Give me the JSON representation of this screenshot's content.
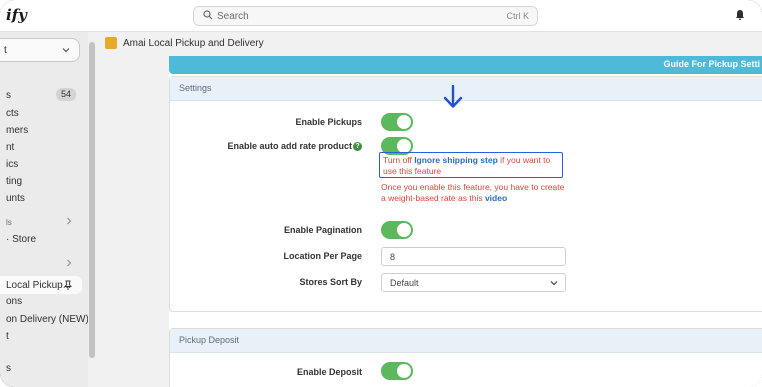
{
  "topbar": {
    "logo": "ify",
    "search_placeholder": "Search",
    "search_shortcut": "Ctrl K"
  },
  "sidebar": {
    "store_select": "t",
    "items": [
      {
        "label": "s",
        "badge": "54"
      },
      {
        "label": "cts"
      },
      {
        "label": "mers"
      },
      {
        "label": "nt"
      },
      {
        "label": "ics"
      },
      {
        "label": "ting"
      },
      {
        "label": "unts"
      }
    ],
    "section_sales": "ls",
    "online_store": "· Store",
    "active_app": "Local Pickup...",
    "sub_items": [
      "ons",
      "on Delivery (NEW)",
      "t"
    ],
    "bottom_item": "s"
  },
  "app": {
    "title": "Amai Local Pickup and Delivery",
    "guide_text": "Guide For Pickup Setti",
    "settings_header": "Settings",
    "rows": {
      "enable_pickups": "Enable Pickups",
      "auto_rate": "Enable auto add rate product",
      "pagination": "Enable Pagination",
      "location_per_page": "Location Per Page",
      "stores_sort_by": "Stores Sort By"
    },
    "warning": {
      "prefix": "Turn off ",
      "link": "Ignore shipping step",
      "suffix": " if you want to use this feature"
    },
    "note": {
      "text": "Once you enable this feature, you have to create a weight-based rate as this ",
      "link": "video"
    },
    "location_per_page_value": "8",
    "sort_by_value": "Default",
    "deposit_header": "Pickup Deposit",
    "enable_deposit": "Enable Deposit"
  },
  "colors": {
    "toggle_on": "#5cb85c",
    "guide_bar": "#4fb9d9",
    "warning_text": "#e0453d",
    "link_blue": "#2a6ebb",
    "highlight_border": "#2b5ed9"
  }
}
